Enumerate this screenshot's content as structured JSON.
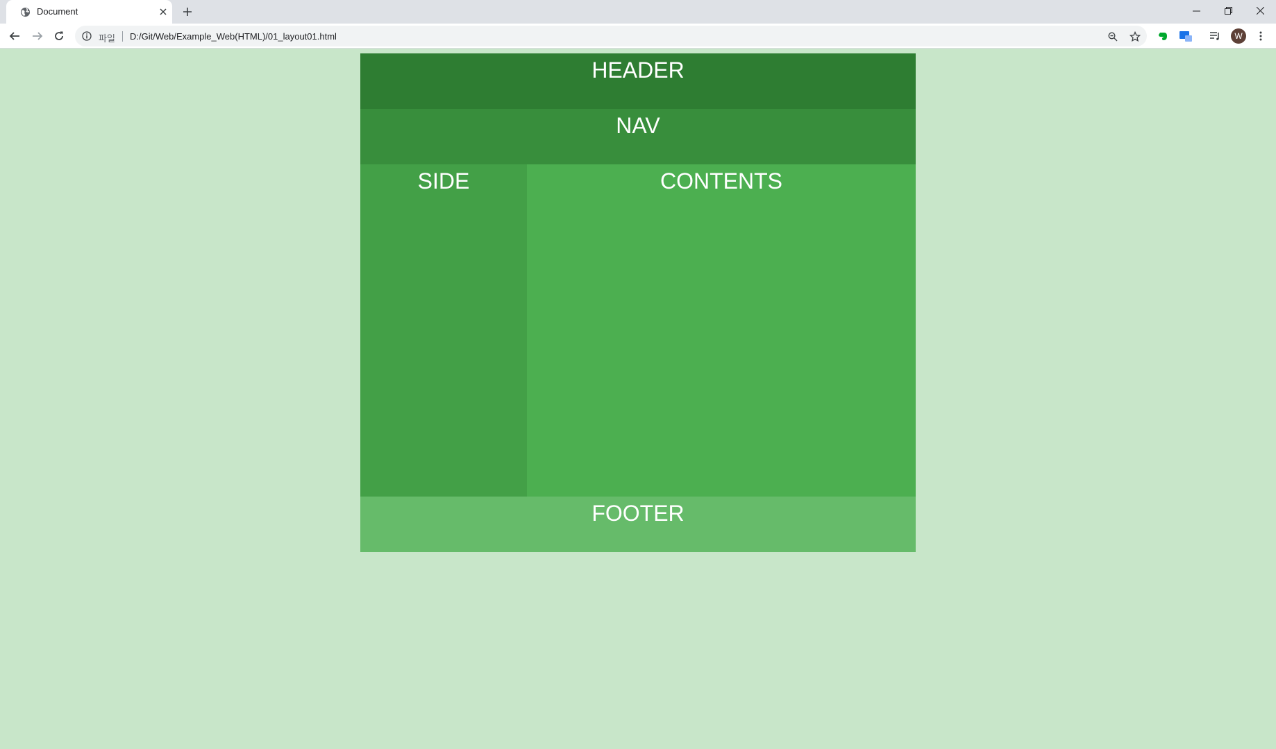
{
  "browser": {
    "tab_title": "Document",
    "url_scheme": "파일",
    "url": "D:/Git/Web/Example_Web(HTML)/01_layout01.html",
    "profile_initial": "W"
  },
  "page": {
    "header": "HEADER",
    "nav": "NAV",
    "side": "SIDE",
    "contents": "CONTENTS",
    "footer": "FOOTER"
  },
  "colors": {
    "page_background": "#c8e6c9",
    "header": "#2e7d32",
    "nav": "#388e3c",
    "side": "#43a047",
    "contents": "#4caf50",
    "footer": "#66bb6a"
  },
  "icons": [
    "globe-icon",
    "close-icon",
    "plus-icon",
    "minimize-icon",
    "restore-icon",
    "back-icon",
    "forward-icon",
    "reload-icon",
    "info-icon",
    "zoom-icon",
    "star-icon",
    "evernote-icon",
    "extension-icon",
    "media-icon",
    "menu-icon"
  ]
}
